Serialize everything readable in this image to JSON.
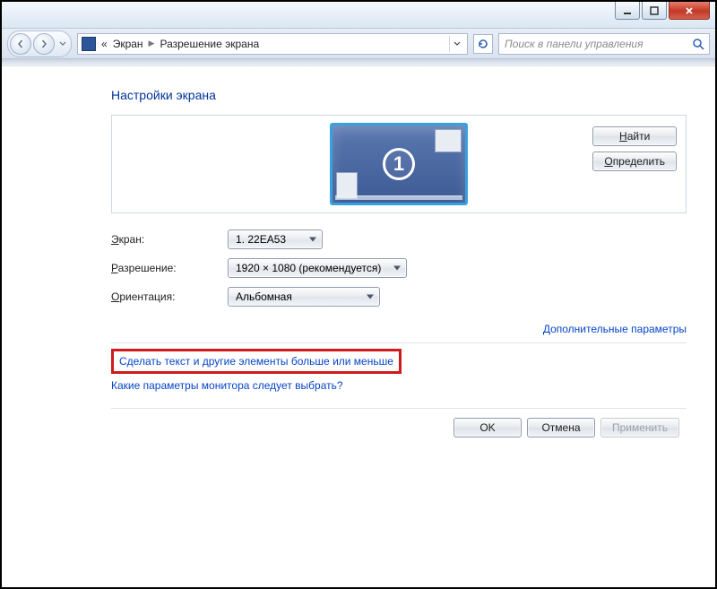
{
  "titlebar": {
    "minimize_icon": "minimize",
    "maximize_icon": "maximize",
    "close_icon": "close"
  },
  "nav": {
    "prefix": "«",
    "crumb1": "Экран",
    "crumb2": "Разрешение экрана"
  },
  "search": {
    "placeholder": "Поиск в панели управления"
  },
  "page": {
    "title": "Настройки экрана"
  },
  "monitor": {
    "number": "1",
    "find_btn": "Найти",
    "find_accel": "Н",
    "identify_btn": "Определить",
    "identify_accel": "О"
  },
  "form": {
    "screen_label": "Экран:",
    "screen_accel": "Э",
    "screen_value": "1. 22EA53",
    "resolution_label": "Разрешение:",
    "resolution_accel": "Р",
    "resolution_value": "1920 × 1080 (рекомендуется)",
    "orientation_label": "Ориентация:",
    "orientation_accel": "О",
    "orientation_value": "Альбомная"
  },
  "links": {
    "advanced": "Дополнительные параметры",
    "text_size": "Сделать текст и другие элементы больше или меньше",
    "which_settings": "Какие параметры монитора следует выбрать?"
  },
  "footer": {
    "ok": "OK",
    "cancel": "Отмена",
    "apply": "Применить"
  }
}
